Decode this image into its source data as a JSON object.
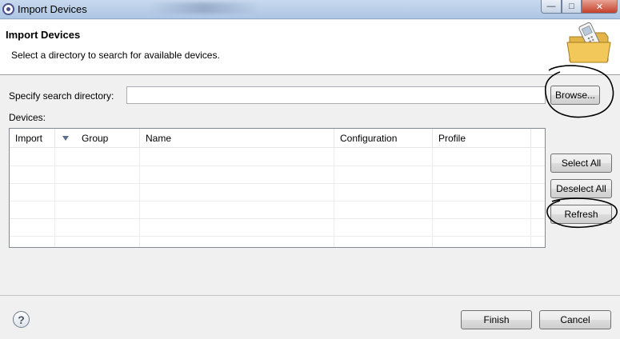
{
  "window": {
    "title": "Import Devices",
    "controls": {
      "minimize": "—",
      "maximize": "□",
      "close": "✕"
    }
  },
  "header": {
    "title": "Import Devices",
    "description": "Select a directory to search for available devices.",
    "icon": "folder-phone-icon"
  },
  "search": {
    "label": "Specify search directory:",
    "value": "",
    "placeholder": "",
    "browse_label": "Browse..."
  },
  "devices": {
    "label": "Devices:",
    "columns": [
      "Import",
      "Group",
      "Name",
      "Configuration",
      "Profile"
    ],
    "sorted_column": "Group",
    "rows": []
  },
  "side_buttons": {
    "select_all": "Select All",
    "deselect_all": "Deselect All",
    "refresh": "Refresh"
  },
  "footer": {
    "help_icon": "?",
    "finish": "Finish",
    "cancel": "Cancel"
  },
  "colors": {
    "titlebar": "#aec6e4",
    "close_button": "#c4402b",
    "dialog_bg": "#f0f0f0",
    "header_bg": "#ffffff"
  }
}
